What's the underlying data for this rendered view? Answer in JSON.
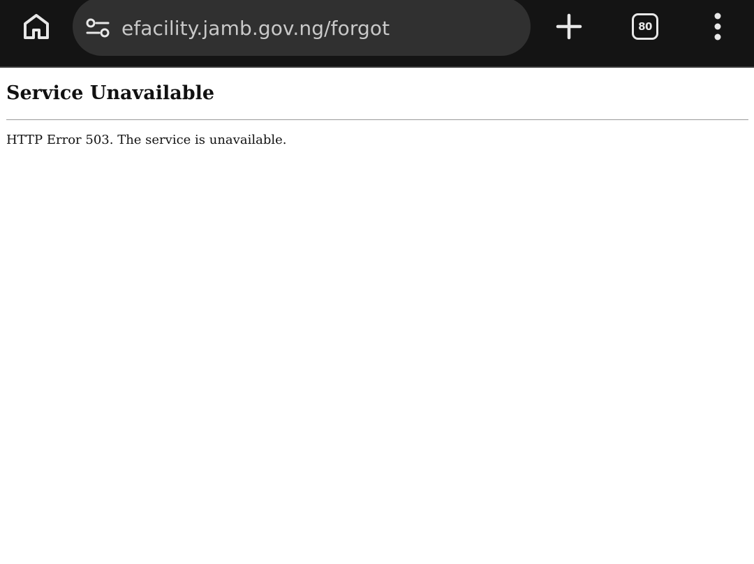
{
  "browser": {
    "url": "efacility.jamb.gov.ng/forgot",
    "tab_count": "80",
    "icons": {
      "home": "home-icon",
      "site_settings": "tune-icon",
      "new_tab": "plus-icon",
      "tabs": "tab-switcher-icon",
      "menu": "more-vert-icon"
    },
    "colors": {
      "toolbar_bg": "#141414",
      "omnibox_bg": "#303030",
      "icon": "#e8e8e8"
    }
  },
  "page": {
    "title": "Service Unavailable",
    "message": "HTTP Error 503. The service is unavailable."
  }
}
